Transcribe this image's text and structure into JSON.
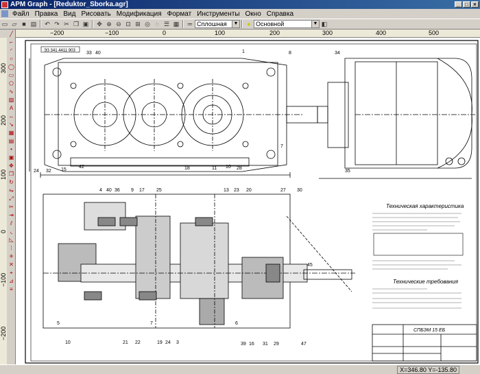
{
  "window": {
    "title": "APM Graph - [Reduktor_Sborka.agr]"
  },
  "menu": {
    "items": [
      "Файл",
      "Правка",
      "Вид",
      "Рисовать",
      "Модификация",
      "Формат",
      "Инструменты",
      "Окно",
      "Справка"
    ]
  },
  "toolbar": {
    "line_style": "Сплошная",
    "layer": "Основной"
  },
  "ruler": {
    "top_labels": [
      "−200",
      "−100",
      "0",
      "100",
      "200",
      "300",
      "400",
      "500"
    ],
    "left_labels": [
      "300",
      "200",
      "100",
      "0",
      "−100",
      "−200"
    ]
  },
  "drawing": {
    "stamp_code": "ЭЗ 341 4411 903",
    "tech_title": "Техническая характеристика",
    "req_title": "Технические требования",
    "doc_code": "СПБЭМ 15 ЕБ",
    "top_leaders": [
      "33",
      "40",
      "1",
      "8",
      "34"
    ],
    "mid_leaders": [
      "4",
      "40",
      "36",
      "9",
      "17",
      "25",
      "13",
      "23",
      "20",
      "27",
      "30"
    ],
    "bottom_leaders": [
      "5",
      "10",
      "21",
      "22",
      "19",
      "24",
      "3",
      "7",
      "6",
      "39",
      "16",
      "31",
      "29",
      "47",
      "45"
    ],
    "side_leaders": [
      "24",
      "32",
      "15",
      "42",
      "18",
      "11",
      "10",
      "28",
      "7",
      "35"
    ]
  },
  "status": {
    "coords": "X=346.80 Y=-135.80"
  }
}
